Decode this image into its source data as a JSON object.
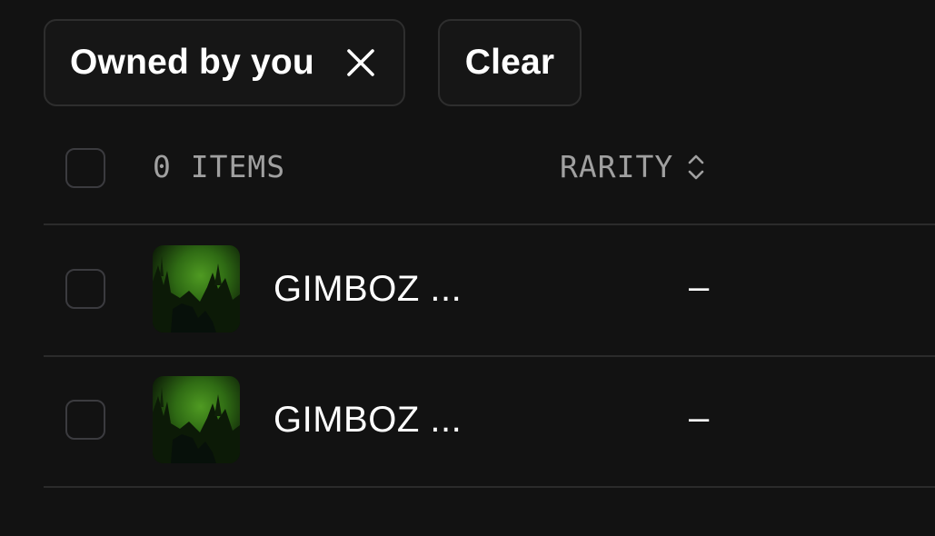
{
  "filters": {
    "owned_label": "Owned by you",
    "clear_label": "Clear"
  },
  "table": {
    "items_count_label": "0 ITEMS",
    "rarity_header": "RARITY",
    "rows": [
      {
        "name": "GIMBOZ ...",
        "rarity": "–"
      },
      {
        "name": "GIMBOZ ...",
        "rarity": "–"
      }
    ]
  },
  "icons": {
    "remove_filter": "close-icon",
    "sort": "sort-updown-icon",
    "checkbox": "checkbox-empty"
  },
  "colors": {
    "background": "#121212",
    "chip_border": "#2e2e2e",
    "muted_text": "#a0a0a0",
    "divider": "#2b2b2b",
    "thumbnail_green": "#2f6b14"
  }
}
